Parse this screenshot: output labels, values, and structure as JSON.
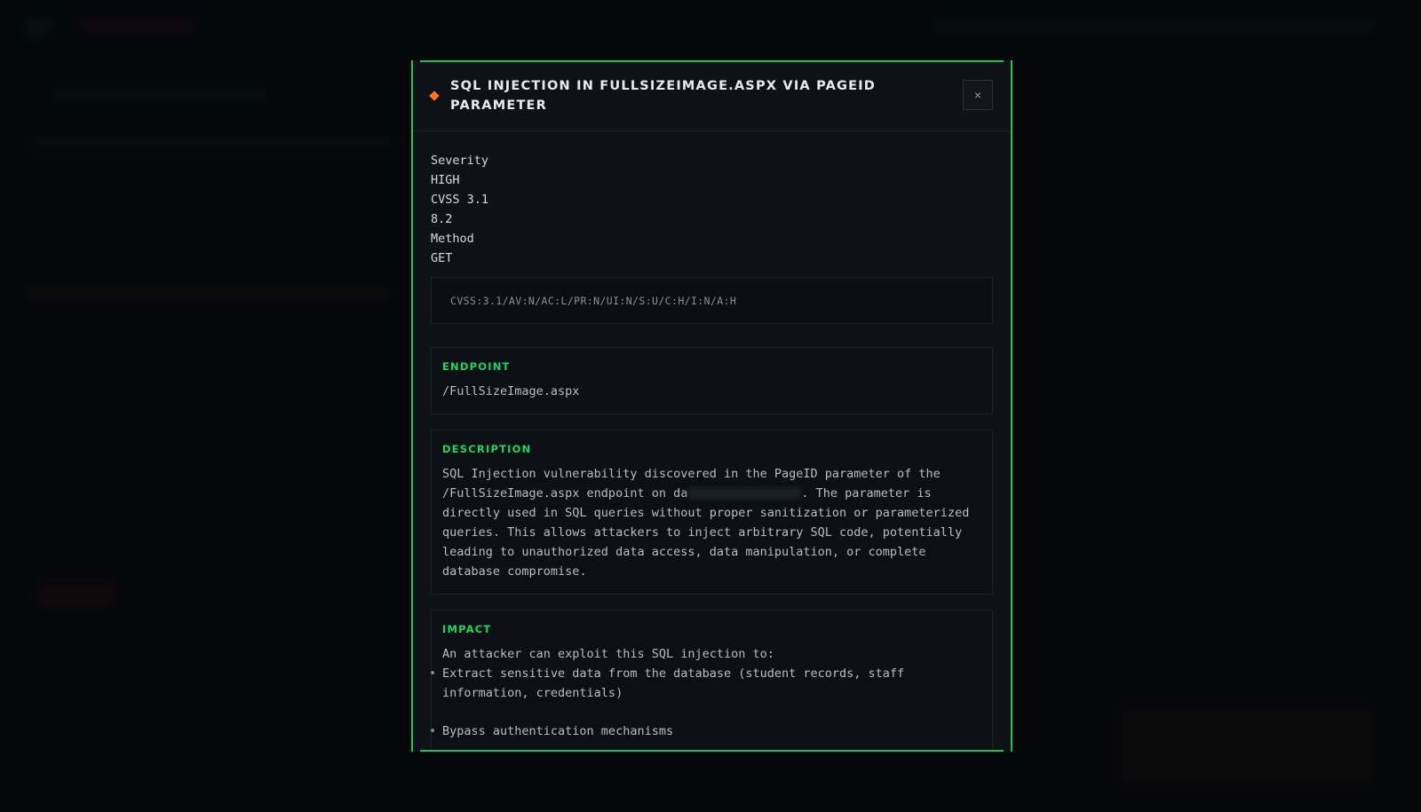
{
  "modal": {
    "title": "SQL INJECTION IN FULLSIZEIMAGE.ASPX VIA PAGEID PARAMETER",
    "close_label": "×",
    "severity_color": "#ff7a1a",
    "accent_color": "#14c75a"
  },
  "meta": {
    "severity_label": "Severity",
    "severity_value": "HIGH",
    "cvss_label": "CVSS 3.1",
    "cvss_value": "8.2",
    "method_label": "Method",
    "method_value": "GET"
  },
  "cvss_vector": "CVSS:3.1/AV:N/AC:L/PR:N/UI:N/S:U/C:H/I:N/A:H",
  "endpoint": {
    "heading": "ENDPOINT",
    "value": "/FullSizeImage.aspx"
  },
  "description": {
    "heading": "DESCRIPTION",
    "text_before": "SQL Injection vulnerability discovered in the PageID parameter of the /FullSizeImage.aspx endpoint on da",
    "text_after": ". The parameter is directly used in SQL queries without proper sanitization or parameterized queries. This allows attackers to inject arbitrary SQL code, potentially leading to unauthorized data access, data manipulation, or complete database compromise."
  },
  "impact": {
    "heading": "IMPACT",
    "intro": "An attacker can exploit this SQL injection to:",
    "items": [
      "Extract sensitive data from the database (student records, staff information, credentials)",
      "Bypass authentication mechanisms"
    ]
  }
}
